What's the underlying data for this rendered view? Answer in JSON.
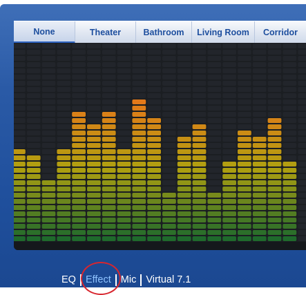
{
  "tabs": [
    {
      "label": "None",
      "active": true
    },
    {
      "label": "Theater",
      "active": false
    },
    {
      "label": "Bathroom",
      "active": false
    },
    {
      "label": "Living Room",
      "active": false
    },
    {
      "label": "Corridor",
      "active": false
    }
  ],
  "equalizer": {
    "levels": [
      0.475,
      0.425,
      0.31,
      0.475,
      0.66,
      0.59,
      0.66,
      0.475,
      0.725,
      0.63,
      0.235,
      0.535,
      0.59,
      0.235,
      0.415,
      0.575,
      0.535,
      0.63,
      0.415
    ],
    "colors": {
      "top": "#e8761a",
      "mid": "#b0a010",
      "bottom": "#1f6a2c",
      "grid": "#30353c",
      "background": "#1b1e22"
    }
  },
  "mode_bar": {
    "items": [
      {
        "label": "EQ",
        "active": false
      },
      {
        "label": "Effect",
        "active": true
      },
      {
        "label": "Mic",
        "active": false
      },
      {
        "label": "Virtual 7.1",
        "active": false
      }
    ]
  },
  "colors": {
    "accent": "#1d4e9e",
    "window": "#2a5aa6",
    "highlight": "#d8262e"
  }
}
